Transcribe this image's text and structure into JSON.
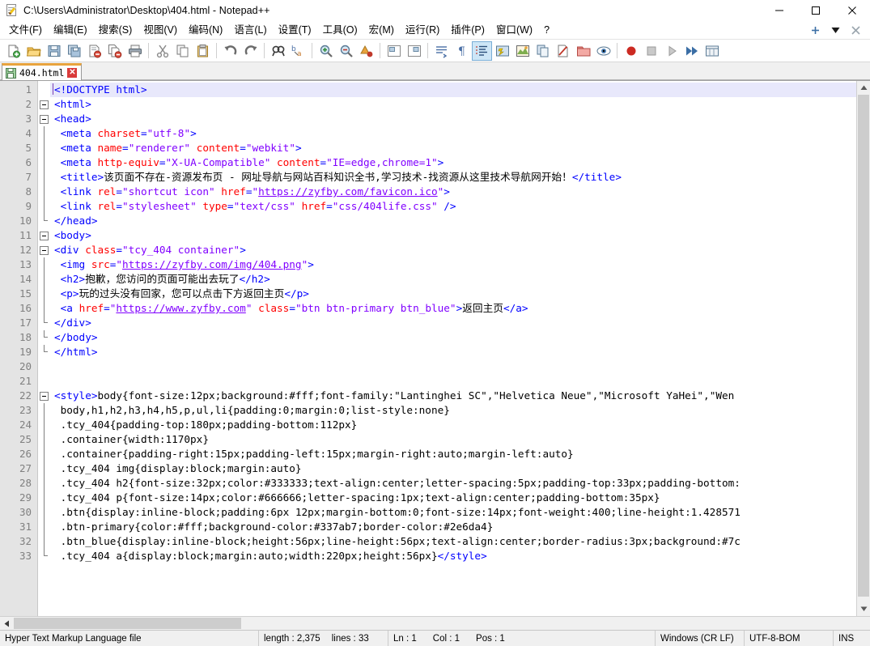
{
  "window": {
    "title": "C:\\Users\\Administrator\\Desktop\\404.html - Notepad++",
    "icon": "notepad-plus-plus-icon",
    "controls": {
      "minimize": "minimize-icon",
      "maximize": "maximize-icon",
      "close": "close-icon"
    }
  },
  "menubar": {
    "items": [
      {
        "label": "文件(F)"
      },
      {
        "label": "编辑(E)"
      },
      {
        "label": "搜索(S)"
      },
      {
        "label": "视图(V)"
      },
      {
        "label": "编码(N)"
      },
      {
        "label": "语言(L)"
      },
      {
        "label": "设置(T)"
      },
      {
        "label": "工具(O)"
      },
      {
        "label": "宏(M)"
      },
      {
        "label": "运行(R)"
      },
      {
        "label": "插件(P)"
      },
      {
        "label": "窗口(W)"
      },
      {
        "label": "?"
      }
    ],
    "right": {
      "add": "+",
      "dropdown": "▼",
      "close": "✕"
    }
  },
  "toolbar": {
    "buttons": [
      {
        "name": "new-file-icon",
        "tip": "新建"
      },
      {
        "name": "open-file-icon",
        "tip": "打开"
      },
      {
        "name": "save-icon",
        "tip": "保存"
      },
      {
        "name": "save-all-icon",
        "tip": "全部保存"
      },
      {
        "name": "close-file-icon",
        "tip": "关闭"
      },
      {
        "name": "close-all-files-icon",
        "tip": "全部关闭"
      },
      {
        "name": "print-icon",
        "tip": "打印"
      },
      {
        "sep": true
      },
      {
        "name": "cut-icon",
        "tip": "剪切"
      },
      {
        "name": "copy-icon",
        "tip": "复制"
      },
      {
        "name": "paste-icon",
        "tip": "粘贴"
      },
      {
        "sep": true
      },
      {
        "name": "undo-icon",
        "tip": "撤销"
      },
      {
        "name": "redo-icon",
        "tip": "恢复"
      },
      {
        "sep": true
      },
      {
        "name": "find-icon",
        "tip": "查找"
      },
      {
        "name": "replace-icon",
        "tip": "替换"
      },
      {
        "sep": true
      },
      {
        "name": "zoom-in-icon",
        "tip": "放大"
      },
      {
        "name": "zoom-out-icon",
        "tip": "缩小"
      },
      {
        "name": "sync-scroll-icon",
        "tip": "同步滚动"
      },
      {
        "sep": true
      },
      {
        "name": "word-wrap-icon",
        "tip": "自动换行"
      },
      {
        "name": "show-all-chars-icon",
        "tip": "显示所有字符"
      },
      {
        "name": "indent-guide-icon",
        "tip": "显示缩进参考线",
        "active": true
      },
      {
        "name": "user-language-icon",
        "tip": "用户自定义语言"
      },
      {
        "name": "doc-map-icon",
        "tip": "文档地图"
      },
      {
        "name": "function-list-icon",
        "tip": "函数列表"
      },
      {
        "name": "edit-mode-icon",
        "tip": "编辑模式"
      },
      {
        "name": "folder-workspace-icon",
        "tip": "文件夹工作区"
      },
      {
        "name": "monitor-icon",
        "tip": "监视文件"
      },
      {
        "sep": true
      },
      {
        "name": "record-macro-icon",
        "tip": "开始录制宏"
      },
      {
        "name": "stop-macro-icon",
        "tip": "停止录制宏"
      },
      {
        "name": "play-macro-icon",
        "tip": "播放宏"
      },
      {
        "name": "run-macro-multiple-icon",
        "tip": "多次运行宏"
      },
      {
        "name": "save-macro-icon",
        "tip": "保存当前录制的宏"
      }
    ]
  },
  "tabs": [
    {
      "label": "404.html",
      "icon": "saved-file-icon",
      "close": "✕",
      "active": true
    }
  ],
  "editor": {
    "line_count": 33,
    "current_line": 1,
    "lines": [
      {
        "n": 1,
        "fold": "none",
        "current": true,
        "tokens": [
          {
            "t": "caret",
            "s": ""
          },
          {
            "t": "tag",
            "s": "<!DOCTYPE html>"
          }
        ]
      },
      {
        "n": 2,
        "fold": "box",
        "tokens": [
          {
            "t": "tag",
            "s": "<html>"
          }
        ]
      },
      {
        "n": 3,
        "fold": "box",
        "tokens": [
          {
            "t": "tag",
            "s": "<head>"
          }
        ]
      },
      {
        "n": 4,
        "fold": "line",
        "tokens": [
          {
            "t": "text",
            "s": " "
          },
          {
            "t": "tag",
            "s": "<meta "
          },
          {
            "t": "attr",
            "s": "charset"
          },
          {
            "t": "tag",
            "s": "="
          },
          {
            "t": "val",
            "s": "\"utf-8\""
          },
          {
            "t": "tag",
            "s": ">"
          }
        ]
      },
      {
        "n": 5,
        "fold": "line",
        "tokens": [
          {
            "t": "text",
            "s": " "
          },
          {
            "t": "tag",
            "s": "<meta "
          },
          {
            "t": "attr",
            "s": "name"
          },
          {
            "t": "tag",
            "s": "="
          },
          {
            "t": "val",
            "s": "\"renderer\""
          },
          {
            "t": "text",
            "s": " "
          },
          {
            "t": "attr",
            "s": "content"
          },
          {
            "t": "tag",
            "s": "="
          },
          {
            "t": "val",
            "s": "\"webkit\""
          },
          {
            "t": "tag",
            "s": ">"
          }
        ]
      },
      {
        "n": 6,
        "fold": "line",
        "tokens": [
          {
            "t": "text",
            "s": " "
          },
          {
            "t": "tag",
            "s": "<meta "
          },
          {
            "t": "attr",
            "s": "http-equiv"
          },
          {
            "t": "tag",
            "s": "="
          },
          {
            "t": "val",
            "s": "\"X-UA-Compatible\""
          },
          {
            "t": "text",
            "s": " "
          },
          {
            "t": "attr",
            "s": "content"
          },
          {
            "t": "tag",
            "s": "="
          },
          {
            "t": "val",
            "s": "\"IE=edge,chrome=1\""
          },
          {
            "t": "tag",
            "s": ">"
          }
        ]
      },
      {
        "n": 7,
        "fold": "line",
        "tokens": [
          {
            "t": "text",
            "s": " "
          },
          {
            "t": "tag",
            "s": "<title>"
          },
          {
            "t": "plain",
            "s": "该页面不存在-资源发布页 - 网址导航与网站百科知识全书,学习技术-找资源从这里技术导航网开始！"
          },
          {
            "t": "tag",
            "s": "</title>"
          }
        ]
      },
      {
        "n": 8,
        "fold": "line",
        "tokens": [
          {
            "t": "text",
            "s": " "
          },
          {
            "t": "tag",
            "s": "<link "
          },
          {
            "t": "attr",
            "s": "rel"
          },
          {
            "t": "tag",
            "s": "="
          },
          {
            "t": "val",
            "s": "\"shortcut icon\""
          },
          {
            "t": "text",
            "s": " "
          },
          {
            "t": "attr",
            "s": "href"
          },
          {
            "t": "tag",
            "s": "="
          },
          {
            "t": "val",
            "s": "\""
          },
          {
            "t": "link",
            "s": "https://zyfby.com/favicon.ico"
          },
          {
            "t": "val",
            "s": "\""
          },
          {
            "t": "tag",
            "s": ">"
          }
        ]
      },
      {
        "n": 9,
        "fold": "line",
        "tokens": [
          {
            "t": "text",
            "s": " "
          },
          {
            "t": "tag",
            "s": "<link "
          },
          {
            "t": "attr",
            "s": "rel"
          },
          {
            "t": "tag",
            "s": "="
          },
          {
            "t": "val",
            "s": "\"stylesheet\""
          },
          {
            "t": "text",
            "s": " "
          },
          {
            "t": "attr",
            "s": "type"
          },
          {
            "t": "tag",
            "s": "="
          },
          {
            "t": "val",
            "s": "\"text/css\""
          },
          {
            "t": "text",
            "s": " "
          },
          {
            "t": "attr",
            "s": "href"
          },
          {
            "t": "tag",
            "s": "="
          },
          {
            "t": "val",
            "s": "\"css/404life.css\""
          },
          {
            "t": "text",
            "s": " "
          },
          {
            "t": "tag",
            "s": "/>"
          }
        ]
      },
      {
        "n": 10,
        "fold": "tail",
        "tokens": [
          {
            "t": "tag",
            "s": "</head>"
          }
        ]
      },
      {
        "n": 11,
        "fold": "box",
        "tokens": [
          {
            "t": "tag",
            "s": "<body>"
          }
        ]
      },
      {
        "n": 12,
        "fold": "box",
        "tokens": [
          {
            "t": "tag",
            "s": "<div "
          },
          {
            "t": "attr",
            "s": "class"
          },
          {
            "t": "tag",
            "s": "="
          },
          {
            "t": "val",
            "s": "\"tcy_404 container\""
          },
          {
            "t": "tag",
            "s": ">"
          }
        ]
      },
      {
        "n": 13,
        "fold": "line",
        "tokens": [
          {
            "t": "text",
            "s": " "
          },
          {
            "t": "tag",
            "s": "<img "
          },
          {
            "t": "attr",
            "s": "src"
          },
          {
            "t": "tag",
            "s": "="
          },
          {
            "t": "val",
            "s": "\""
          },
          {
            "t": "link",
            "s": "https://zyfby.com/img/404.png"
          },
          {
            "t": "val",
            "s": "\""
          },
          {
            "t": "tag",
            "s": ">"
          }
        ]
      },
      {
        "n": 14,
        "fold": "line",
        "tokens": [
          {
            "t": "text",
            "s": " "
          },
          {
            "t": "tag",
            "s": "<h2>"
          },
          {
            "t": "plain",
            "s": "抱歉，您访问的页面可能出去玩了"
          },
          {
            "t": "tag",
            "s": "</h2>"
          }
        ]
      },
      {
        "n": 15,
        "fold": "line",
        "tokens": [
          {
            "t": "text",
            "s": " "
          },
          {
            "t": "tag",
            "s": "<p>"
          },
          {
            "t": "plain",
            "s": "玩的过头没有回家，您可以点击下方返回主页"
          },
          {
            "t": "tag",
            "s": "</p>"
          }
        ]
      },
      {
        "n": 16,
        "fold": "line",
        "tokens": [
          {
            "t": "text",
            "s": " "
          },
          {
            "t": "tag",
            "s": "<a "
          },
          {
            "t": "attr",
            "s": "href"
          },
          {
            "t": "tag",
            "s": "="
          },
          {
            "t": "val",
            "s": "\""
          },
          {
            "t": "link",
            "s": "https://www.zyfby.com"
          },
          {
            "t": "val",
            "s": "\""
          },
          {
            "t": "text",
            "s": " "
          },
          {
            "t": "attr",
            "s": "class"
          },
          {
            "t": "tag",
            "s": "="
          },
          {
            "t": "val",
            "s": "\"btn btn-primary btn_blue\""
          },
          {
            "t": "tag",
            "s": ">"
          },
          {
            "t": "plain",
            "s": "返回主页"
          },
          {
            "t": "tag",
            "s": "</a>"
          }
        ]
      },
      {
        "n": 17,
        "fold": "tail",
        "tokens": [
          {
            "t": "tag",
            "s": "</div>"
          }
        ]
      },
      {
        "n": 18,
        "fold": "tail",
        "tokens": [
          {
            "t": "tag",
            "s": "</body>"
          }
        ]
      },
      {
        "n": 19,
        "fold": "tail",
        "tokens": [
          {
            "t": "tag",
            "s": "</html>"
          }
        ]
      },
      {
        "n": 20,
        "fold": "none",
        "tokens": []
      },
      {
        "n": 21,
        "fold": "none",
        "tokens": []
      },
      {
        "n": 22,
        "fold": "box",
        "tokens": [
          {
            "t": "tag",
            "s": "<style>"
          },
          {
            "t": "plain",
            "s": "body{font-size:12px;background:#fff;font-family:\"Lantinghei SC\",\"Helvetica Neue\",\"Microsoft YaHei\",\"Wen"
          }
        ]
      },
      {
        "n": 23,
        "fold": "line",
        "tokens": [
          {
            "t": "plain",
            "s": " body,h1,h2,h3,h4,h5,p,ul,li{padding:0;margin:0;list-style:none}"
          }
        ]
      },
      {
        "n": 24,
        "fold": "line",
        "tokens": [
          {
            "t": "plain",
            "s": " .tcy_404{padding-top:180px;padding-bottom:112px}"
          }
        ]
      },
      {
        "n": 25,
        "fold": "line",
        "tokens": [
          {
            "t": "plain",
            "s": " .container{width:1170px}"
          }
        ]
      },
      {
        "n": 26,
        "fold": "line",
        "tokens": [
          {
            "t": "plain",
            "s": " .container{padding-right:15px;padding-left:15px;margin-right:auto;margin-left:auto}"
          }
        ]
      },
      {
        "n": 27,
        "fold": "line",
        "tokens": [
          {
            "t": "plain",
            "s": " .tcy_404 img{display:block;margin:auto}"
          }
        ]
      },
      {
        "n": 28,
        "fold": "line",
        "tokens": [
          {
            "t": "plain",
            "s": " .tcy_404 h2{font-size:32px;color:#333333;text-align:center;letter-spacing:5px;padding-top:33px;padding-bottom:"
          }
        ]
      },
      {
        "n": 29,
        "fold": "line",
        "tokens": [
          {
            "t": "plain",
            "s": " .tcy_404 p{font-size:14px;color:#666666;letter-spacing:1px;text-align:center;padding-bottom:35px}"
          }
        ]
      },
      {
        "n": 30,
        "fold": "line",
        "tokens": [
          {
            "t": "plain",
            "s": " .btn{display:inline-block;padding:6px 12px;margin-bottom:0;font-size:14px;font-weight:400;line-height:1.428571"
          }
        ]
      },
      {
        "n": 31,
        "fold": "line",
        "tokens": [
          {
            "t": "plain",
            "s": " .btn-primary{color:#fff;background-color:#337ab7;border-color:#2e6da4}"
          }
        ]
      },
      {
        "n": 32,
        "fold": "line",
        "tokens": [
          {
            "t": "plain",
            "s": " .btn_blue{display:inline-block;height:56px;line-height:56px;text-align:center;border-radius:3px;background:#7c"
          }
        ]
      },
      {
        "n": 33,
        "fold": "tail",
        "tokens": [
          {
            "t": "plain",
            "s": " .tcy_404 a{display:block;margin:auto;width:220px;height:56px}"
          },
          {
            "t": "tag",
            "s": "</style>"
          }
        ]
      }
    ]
  },
  "statusbar": {
    "doc_type": "Hyper Text Markup Language file",
    "length_label": "length : 2,375",
    "lines_label": "lines : 33",
    "ln": "Ln : 1",
    "col": "Col : 1",
    "pos": "Pos : 1",
    "eol": "Windows (CR LF)",
    "encoding": "UTF-8-BOM",
    "insert_mode": "INS"
  },
  "colors": {
    "tag": "#0000ff",
    "attribute": "#ff0000",
    "value": "#8000ff",
    "text": "#000000",
    "tab_accent": "#e8a33d",
    "current_line_bg": "#e8e8fb",
    "gutter_bg": "#e4e4e4"
  }
}
